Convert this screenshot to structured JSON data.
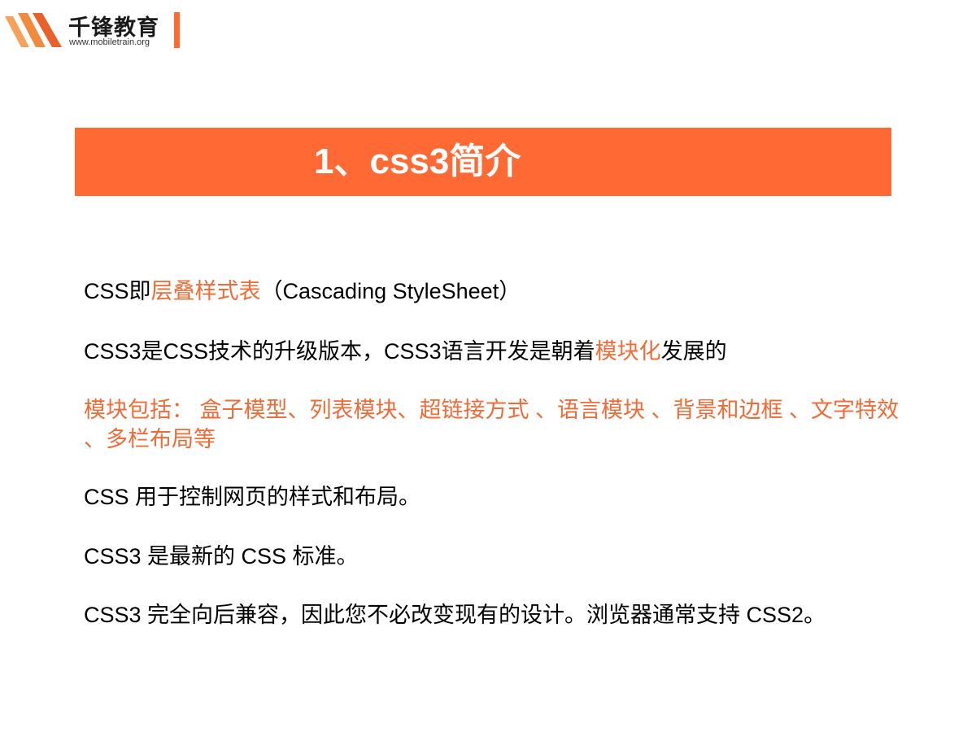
{
  "logo": {
    "name": "千锋教育",
    "url": "www.mobiletrain.org"
  },
  "colors": {
    "accent": "#ff6a34",
    "highlight_text": "#ef6b36",
    "body_text": "#000000"
  },
  "title": "1、css3简介",
  "content": {
    "line1": {
      "prefix": "CSS即",
      "highlight": "层叠样式表",
      "suffix": "（Cascading StyleSheet）"
    },
    "line2": {
      "prefix": "CSS3是CSS技术的升级版本，CSS3语言开发是朝着",
      "highlight": "模块化",
      "suffix": "发展的"
    },
    "line3": "模块包括： 盒子模型、列表模块、超链接方式 、语言模块 、背景和边框 、文字特效 、多栏布局等",
    "line4": "CSS 用于控制网页的样式和布局。",
    "line5": "CSS3 是最新的 CSS 标准。",
    "line6": "CSS3 完全向后兼容，因此您不必改变现有的设计。浏览器通常支持 CSS2。"
  }
}
